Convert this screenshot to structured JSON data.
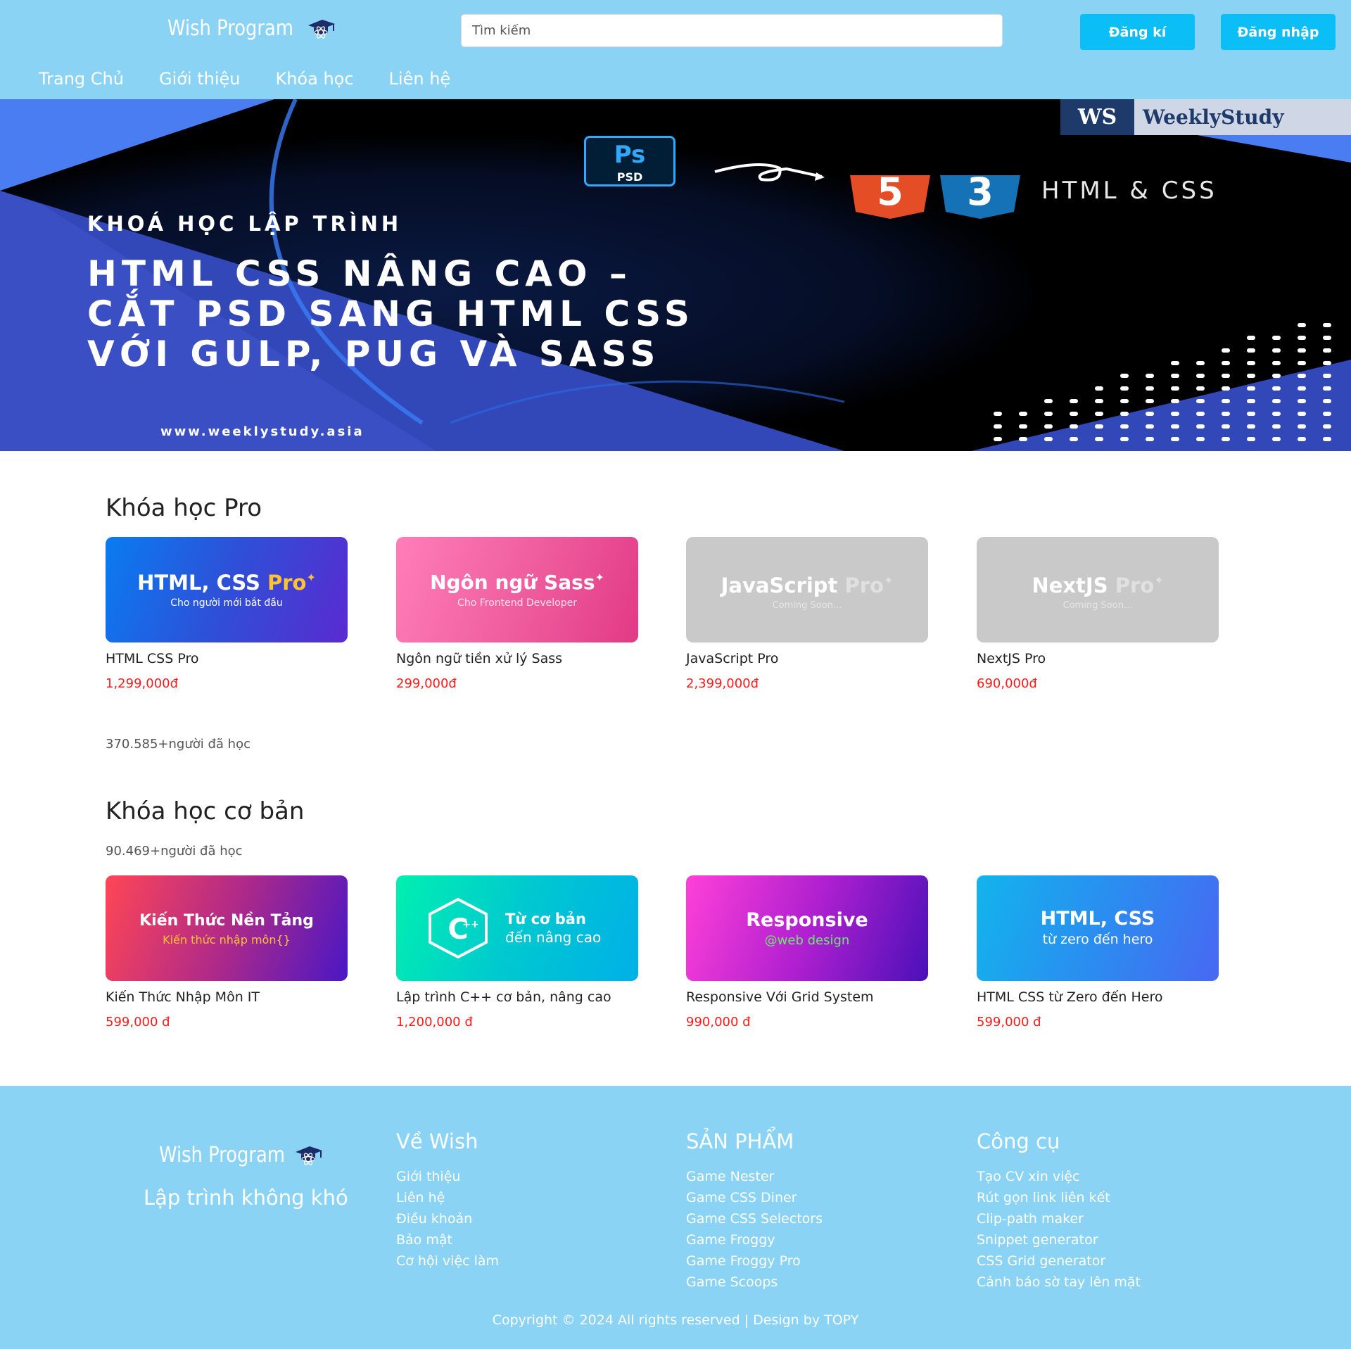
{
  "header": {
    "logo_text": "Wish Program",
    "search_placeholder": "Tìm kiếm",
    "register_label": "Đăng kí",
    "login_label": "Đăng nhập",
    "nav": [
      "Trang Chủ",
      "Giới thiệu",
      "Khóa học",
      "Liên hệ"
    ]
  },
  "banner": {
    "brand_mark": "WS",
    "brand_name": "WeeklyStudy",
    "ps_big": "Ps",
    "ps_small": "PSD",
    "html5_badge": "5",
    "css3_badge": "3",
    "tech_label": "HTML & CSS",
    "subtitle": "KHOÁ HỌC LẬP TRÌNH",
    "title_lines": [
      "HTML CSS NÂNG CAO –",
      "CẮT PSD SANG HTML CSS",
      "VỚI GULP, PUG VÀ SASS"
    ],
    "url": "www.weeklystudy.asia"
  },
  "pro": {
    "title": "Khóa học Pro",
    "learners": "370.585+người đã học",
    "courses": [
      {
        "thumb_title": "HTML, CSS",
        "thumb_title_accent": "Pro",
        "thumb_sub": "Cho người mới bắt đầu",
        "name": "HTML CSS Pro",
        "price": "1,299,000đ"
      },
      {
        "thumb_title": "Ngôn ngữ Sass",
        "thumb_title_accent": "",
        "thumb_sub": "Cho Frontend Developer",
        "name": "Ngôn ngữ tiền xử lý Sass",
        "price": "299,000đ"
      },
      {
        "thumb_title": "JavaScript",
        "thumb_title_accent": "Pro",
        "thumb_sub": "Coming Soon...",
        "name": "JavaScript Pro",
        "price": "2,399,000đ"
      },
      {
        "thumb_title": "NextJS",
        "thumb_title_accent": "Pro",
        "thumb_sub": "Coming Soon...",
        "name": "NextJS Pro",
        "price": "690,000đ"
      }
    ]
  },
  "basic": {
    "title": "Khóa học cơ bản",
    "learners": "90.469+người đã học",
    "courses": [
      {
        "thumb_title": "Kiến Thức Nền Tảng",
        "thumb_sub": "Kiến thức nhập môn{}",
        "name": "Kiến Thức Nhập Môn IT",
        "price": "599,000 đ"
      },
      {
        "thumb_title": "Từ cơ bản",
        "thumb_sub": "đến nâng cao",
        "name": "Lập trình C++ cơ bản, nâng cao",
        "price": "1,200,000 đ"
      },
      {
        "thumb_title": "Responsive",
        "thumb_sub": "@web design",
        "name": "Responsive Với Grid System",
        "price": "990,000 đ"
      },
      {
        "thumb_title": "HTML, CSS",
        "thumb_sub": "từ zero đến hero",
        "name": "HTML CSS từ Zero đến Hero",
        "price": "599,000 đ"
      }
    ]
  },
  "footer": {
    "logo_text": "Wish Program",
    "slogan": "Lập trình không khó",
    "columns": [
      {
        "heading": "Về Wish",
        "links": [
          "Giới thiệu",
          "Liên hệ",
          "Điều khoản",
          "Bảo mật",
          "Cơ hội việc làm"
        ]
      },
      {
        "heading": "SẢN PHẨM",
        "links": [
          "Game Nester",
          "Game CSS Diner",
          "Game CSS Selectors",
          "Game Froggy",
          "Game Froggy Pro",
          "Game Scoops"
        ]
      },
      {
        "heading": "Công cụ",
        "links": [
          "Tạo CV xin việc",
          "Rút gọn link liên kết",
          "Clip-path maker",
          "Snippet generator",
          "CSS Grid generator",
          "Cảnh báo sờ tay lên mặt"
        ]
      }
    ],
    "copyright": "Copyright © 2024 All rights reserved | Design by TOPY"
  },
  "colors": {
    "header_bg": "#8ad3f4",
    "button_bg": "#0bbef6",
    "price_red": "#ff1a1a"
  },
  "icons": [
    "graduation-cap-icon"
  ]
}
